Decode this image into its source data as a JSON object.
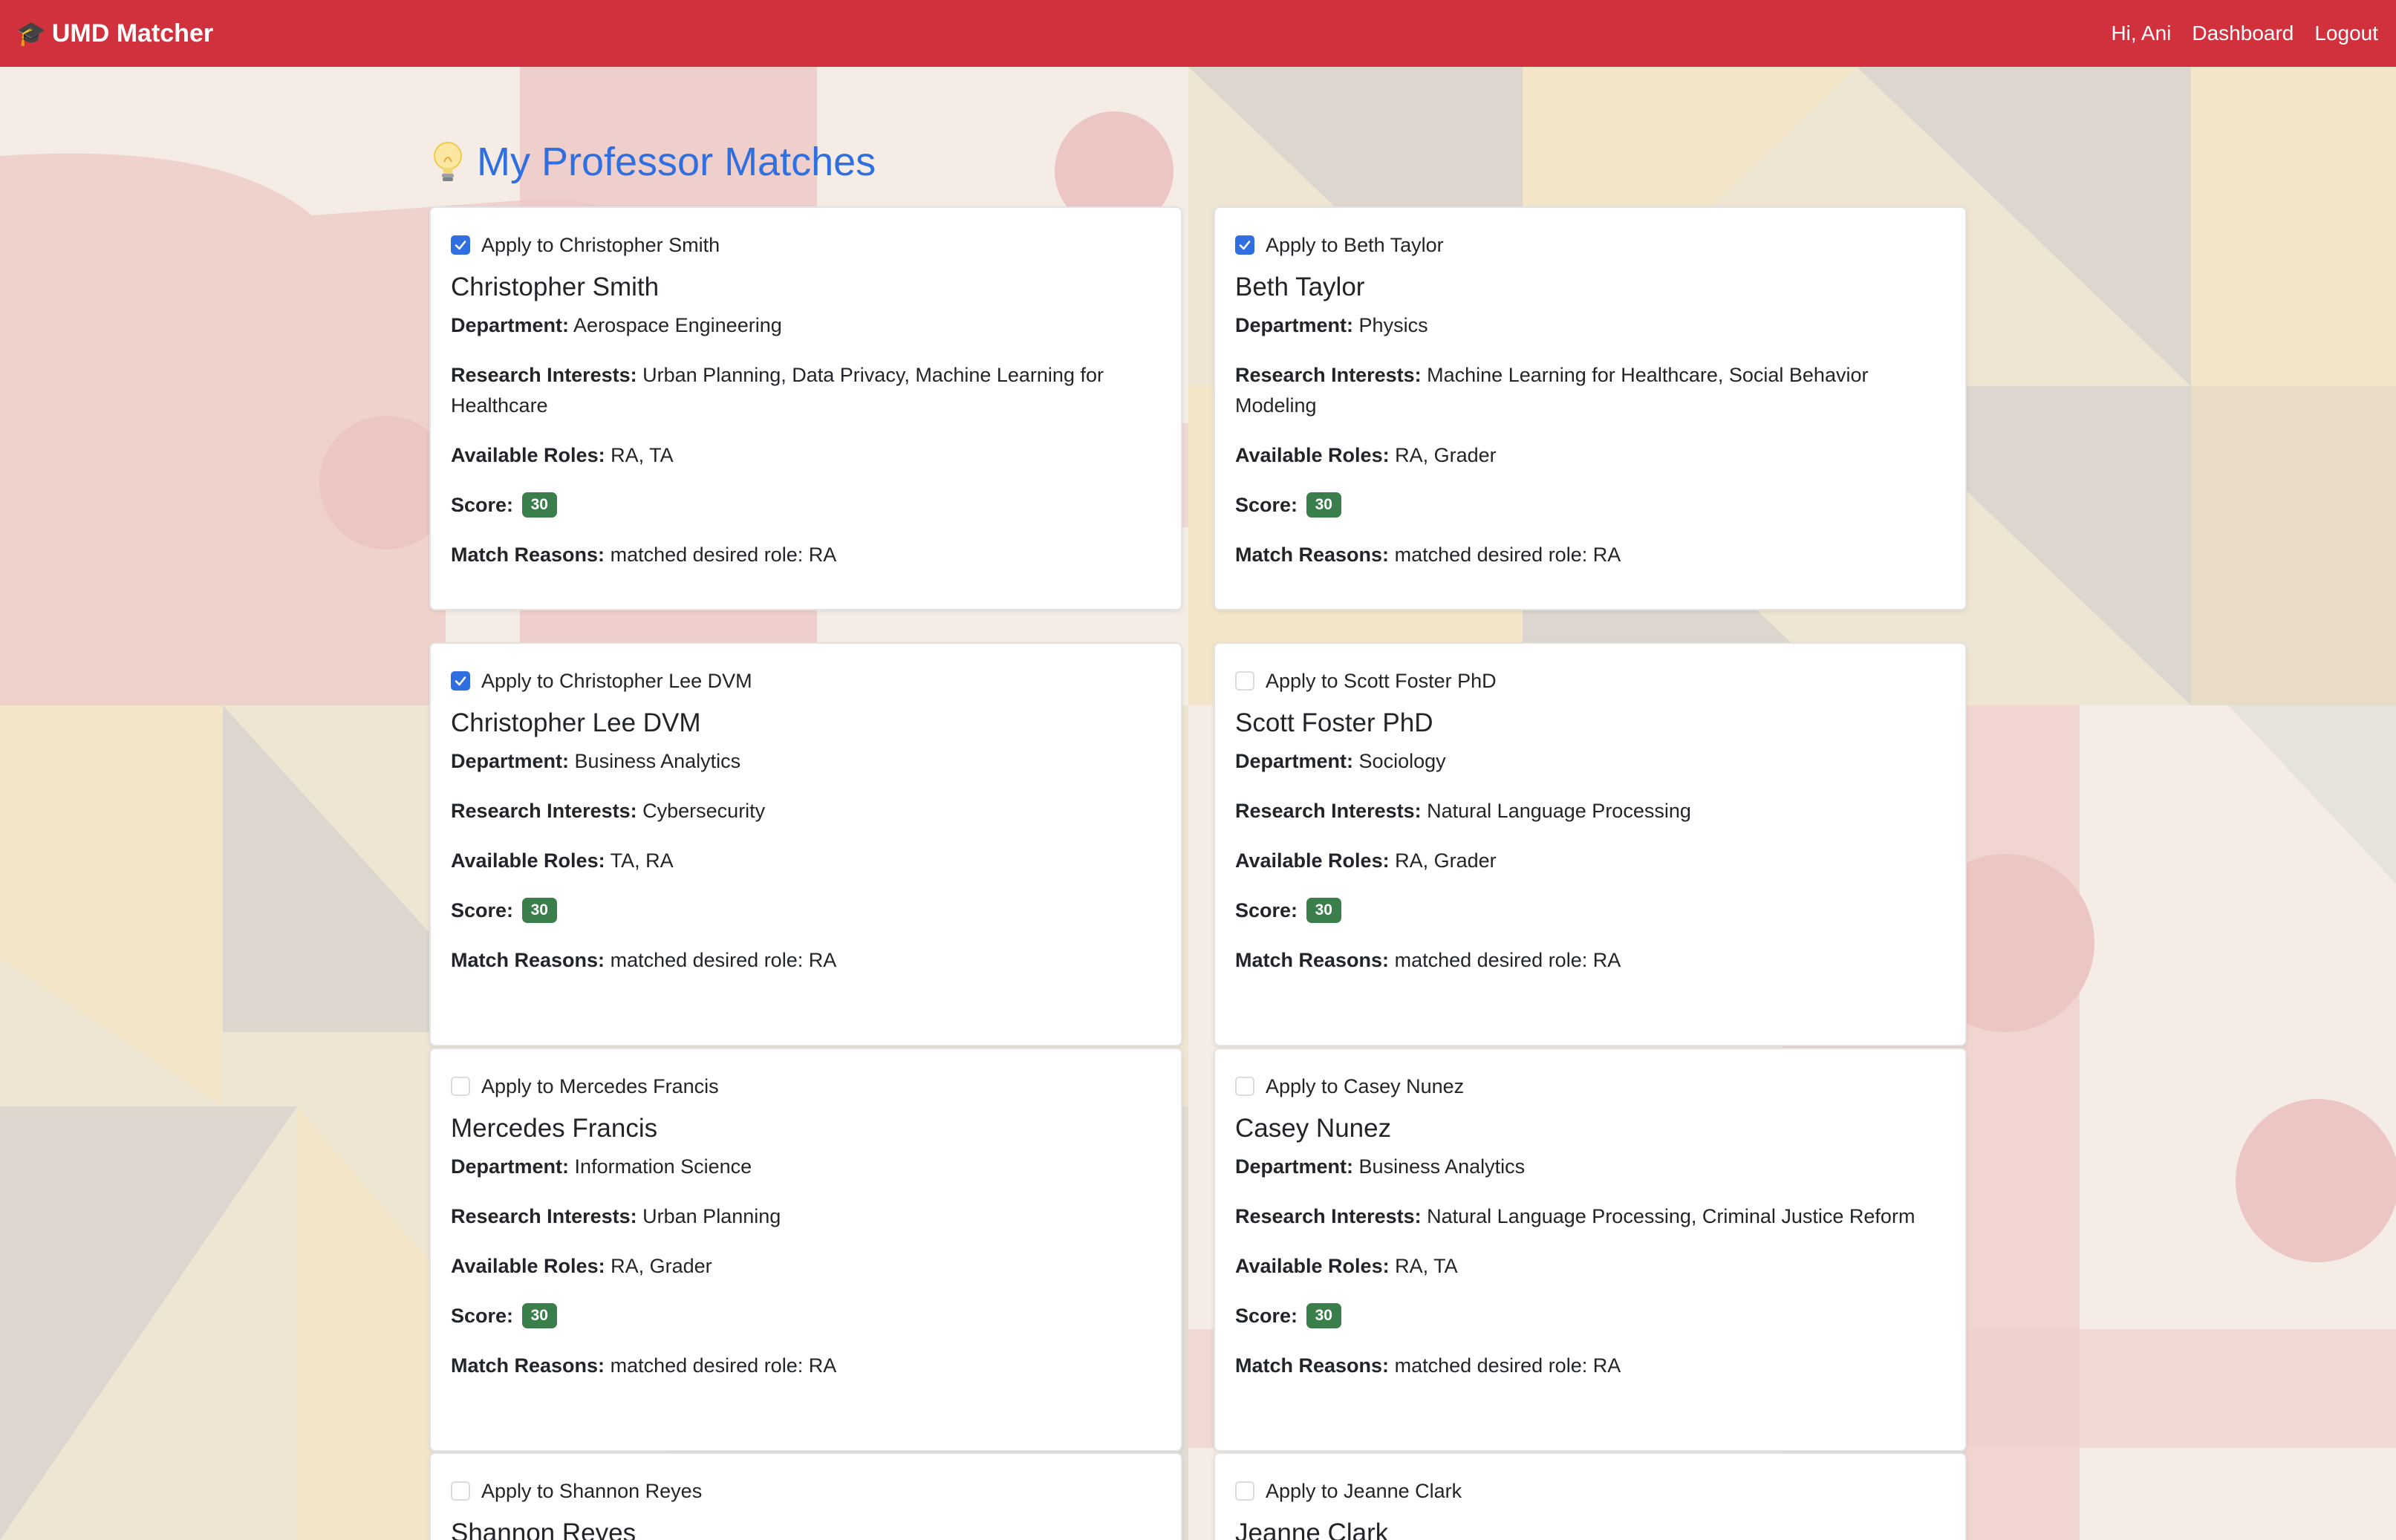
{
  "nav": {
    "brand": "UMD Matcher",
    "greeting": "Hi, Ani",
    "dashboard": "Dashboard",
    "logout": "Logout"
  },
  "page": {
    "title": "My Professor Matches"
  },
  "labels": {
    "department": "Department:",
    "research": "Research Interests:",
    "roles": "Available Roles:",
    "score": "Score:",
    "reasons": "Match Reasons:"
  },
  "colors": {
    "navbar": "#d0313c",
    "title": "#2f6fe0",
    "badge": "#3a7f4b",
    "checkbox": "#2f6fe0"
  },
  "matches": [
    {
      "apply_label": "Apply to Christopher Smith",
      "checked": true,
      "name": "Christopher Smith",
      "department": "Aerospace Engineering",
      "research": "Urban Planning, Data Privacy, Machine Learning for Healthcare",
      "roles": "RA, TA",
      "score": "30",
      "reasons": "matched desired role: RA"
    },
    {
      "apply_label": "Apply to Beth Taylor",
      "checked": true,
      "name": "Beth Taylor",
      "department": "Physics",
      "research": "Machine Learning for Healthcare, Social Behavior Modeling",
      "roles": "RA, Grader",
      "score": "30",
      "reasons": "matched desired role: RA"
    },
    {
      "apply_label": "Apply to Christopher Lee DVM",
      "checked": true,
      "name": "Christopher Lee DVM",
      "department": "Business Analytics",
      "research": "Cybersecurity",
      "roles": "TA, RA",
      "score": "30",
      "reasons": "matched desired role: RA"
    },
    {
      "apply_label": "Apply to Scott Foster PhD",
      "checked": false,
      "name": "Scott Foster PhD",
      "department": "Sociology",
      "research": "Natural Language Processing",
      "roles": "RA, Grader",
      "score": "30",
      "reasons": "matched desired role: RA"
    },
    {
      "apply_label": "Apply to Mercedes Francis",
      "checked": false,
      "name": "Mercedes Francis",
      "department": "Information Science",
      "research": "Urban Planning",
      "roles": "RA, Grader",
      "score": "30",
      "reasons": "matched desired role: RA"
    },
    {
      "apply_label": "Apply to Casey Nunez",
      "checked": false,
      "name": "Casey Nunez",
      "department": "Business Analytics",
      "research": "Natural Language Processing, Criminal Justice Reform",
      "roles": "RA, TA",
      "score": "30",
      "reasons": "matched desired role: RA"
    },
    {
      "apply_label": "Apply to Shannon Reyes",
      "checked": false,
      "name": "Shannon Reyes"
    },
    {
      "apply_label": "Apply to Jeanne Clark",
      "checked": false,
      "name": "Jeanne Clark"
    }
  ]
}
